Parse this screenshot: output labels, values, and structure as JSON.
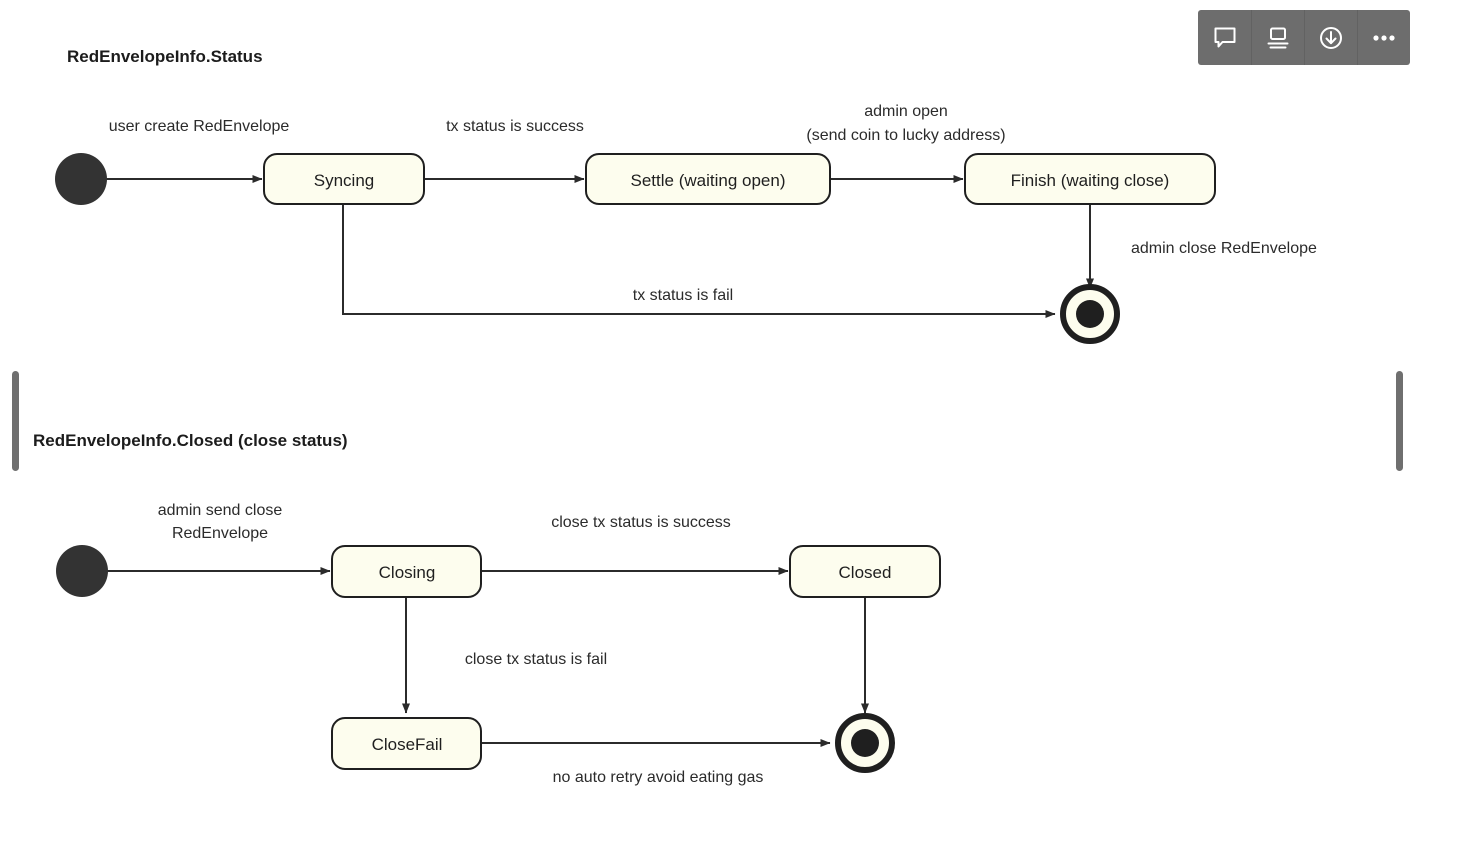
{
  "toolbar": {
    "buttons": [
      {
        "name": "comment-icon",
        "label": "Comment"
      },
      {
        "name": "present-icon",
        "label": "Present"
      },
      {
        "name": "download-icon",
        "label": "Download"
      },
      {
        "name": "more-icon",
        "label": "More"
      }
    ]
  },
  "colors": {
    "node_fill": "#fdfdee",
    "node_stroke": "#1f1f1f",
    "start_fill": "#333333",
    "toolbar_bg": "#6d6d6d",
    "handle": "#6f6f6f",
    "background": "#ffffff"
  },
  "sections": [
    {
      "title": "RedEnvelopeInfo.Status",
      "nodes": [
        {
          "id": "start1",
          "type": "start",
          "label": ""
        },
        {
          "id": "syncing",
          "type": "state",
          "label": "Syncing"
        },
        {
          "id": "settle",
          "type": "state",
          "label": "Settle  (waiting open)"
        },
        {
          "id": "finish",
          "type": "state",
          "label": "Finish  (waiting close)"
        },
        {
          "id": "end1",
          "type": "end",
          "label": ""
        }
      ],
      "edges": [
        {
          "from": "start1",
          "to": "syncing",
          "label": "user create RedEnvelope"
        },
        {
          "from": "syncing",
          "to": "settle",
          "label": "tx status is success"
        },
        {
          "from": "settle",
          "to": "finish",
          "label_line1": "admin open",
          "label_line2": "(send coin to lucky address)"
        },
        {
          "from": "finish",
          "to": "end1",
          "label": "admin close RedEnvelope"
        },
        {
          "from": "syncing",
          "to": "end1",
          "label": "tx status is fail"
        }
      ]
    },
    {
      "title": "RedEnvelopeInfo.Closed  (close status)",
      "nodes": [
        {
          "id": "start2",
          "type": "start",
          "label": ""
        },
        {
          "id": "closing",
          "type": "state",
          "label": "Closing"
        },
        {
          "id": "closed",
          "type": "state",
          "label": "Closed"
        },
        {
          "id": "closefail",
          "type": "state",
          "label": "CloseFail"
        },
        {
          "id": "end2",
          "type": "end",
          "label": ""
        }
      ],
      "edges": [
        {
          "from": "start2",
          "to": "closing",
          "label_line1": "admin send close",
          "label_line2": "RedEnvelope"
        },
        {
          "from": "closing",
          "to": "closed",
          "label": "close tx status is success"
        },
        {
          "from": "closing",
          "to": "closefail",
          "label": "close tx status is fail"
        },
        {
          "from": "closed",
          "to": "end2",
          "label": ""
        },
        {
          "from": "closefail",
          "to": "end2",
          "label": "no auto retry avoid eating gas"
        }
      ]
    }
  ]
}
